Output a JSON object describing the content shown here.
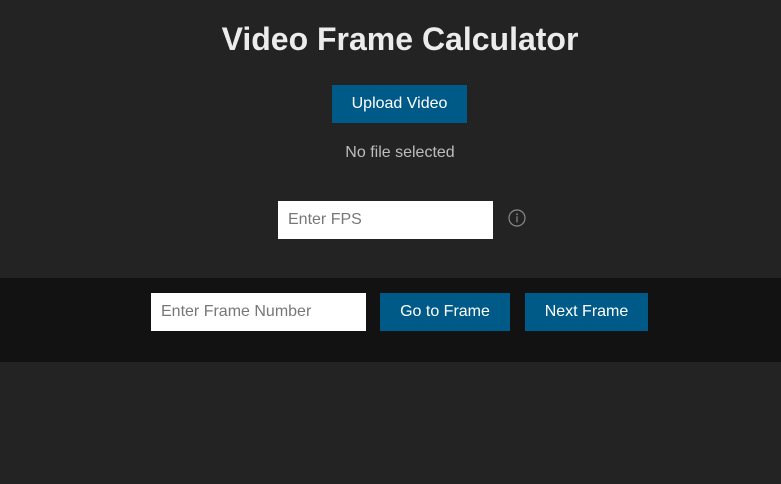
{
  "header": {
    "title": "Video Frame Calculator"
  },
  "upload": {
    "button_label": "Upload Video",
    "file_status": "No file selected"
  },
  "fps": {
    "placeholder": "Enter FPS",
    "value": "",
    "info_icon": "info-circle-icon"
  },
  "controls": {
    "frame_placeholder": "Enter Frame Number",
    "frame_value": "",
    "goto_label": "Go to Frame",
    "next_label": "Next Frame"
  },
  "colors": {
    "background": "#232323",
    "control_bar": "#121212",
    "accent_button": "#005a87",
    "title_text": "#ececec",
    "status_text": "#bdbdbd"
  }
}
